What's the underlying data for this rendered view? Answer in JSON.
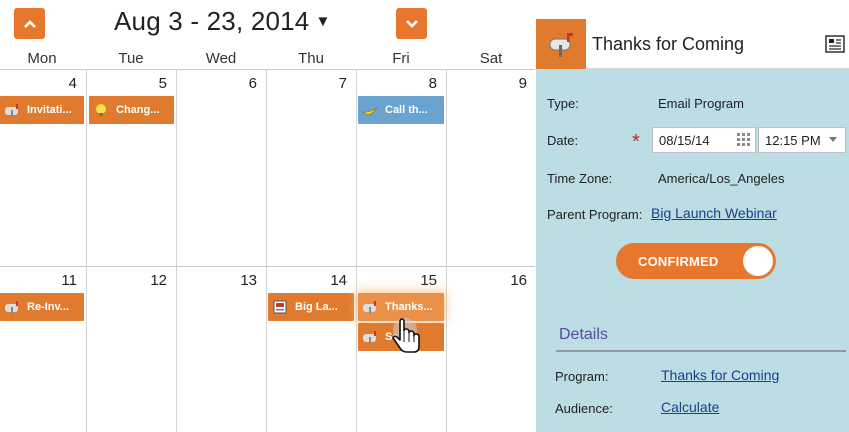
{
  "calendar": {
    "date_range": "Aug 3 - 23, 2014",
    "days": [
      "Mon",
      "Tue",
      "Wed",
      "Thu",
      "Fri",
      "Sat"
    ],
    "week1_dates": [
      "4",
      "5",
      "6",
      "7",
      "8",
      "9"
    ],
    "week2_dates": [
      "11",
      "12",
      "13",
      "14",
      "15",
      "16"
    ],
    "events": {
      "mon_4": "Invitati...",
      "tue_5": "Chang...",
      "fri_8": "Call th...",
      "mon_11": "Re-Inv...",
      "thu_14": "Big La...",
      "fri_15_a": "Thanks...",
      "fri_15_b": "Se..."
    },
    "colors": {
      "event_orange": "#e07a2e",
      "event_blue": "#6aa3cf",
      "nav": "#e8772e"
    }
  },
  "panel": {
    "title": "Thanks for Coming",
    "type_label": "Type:",
    "type_value": "Email Program",
    "date_label": "Date:",
    "date_value": "08/15/14",
    "time_value": "12:15 PM",
    "timezone_label": "Time Zone:",
    "timezone_value": "America/Los_Angeles",
    "parent_label": "Parent Program:",
    "parent_value": "Big Launch Webinar",
    "toggle_label": "CONFIRMED",
    "details_title": "Details",
    "program_label": "Program:",
    "program_value": "Thanks for Coming",
    "audience_label": "Audience:",
    "audience_value": "Calculate",
    "colors": {
      "background": "#bcdde4",
      "link": "#1b3f8b",
      "details_heading": "#5a4b99"
    }
  }
}
